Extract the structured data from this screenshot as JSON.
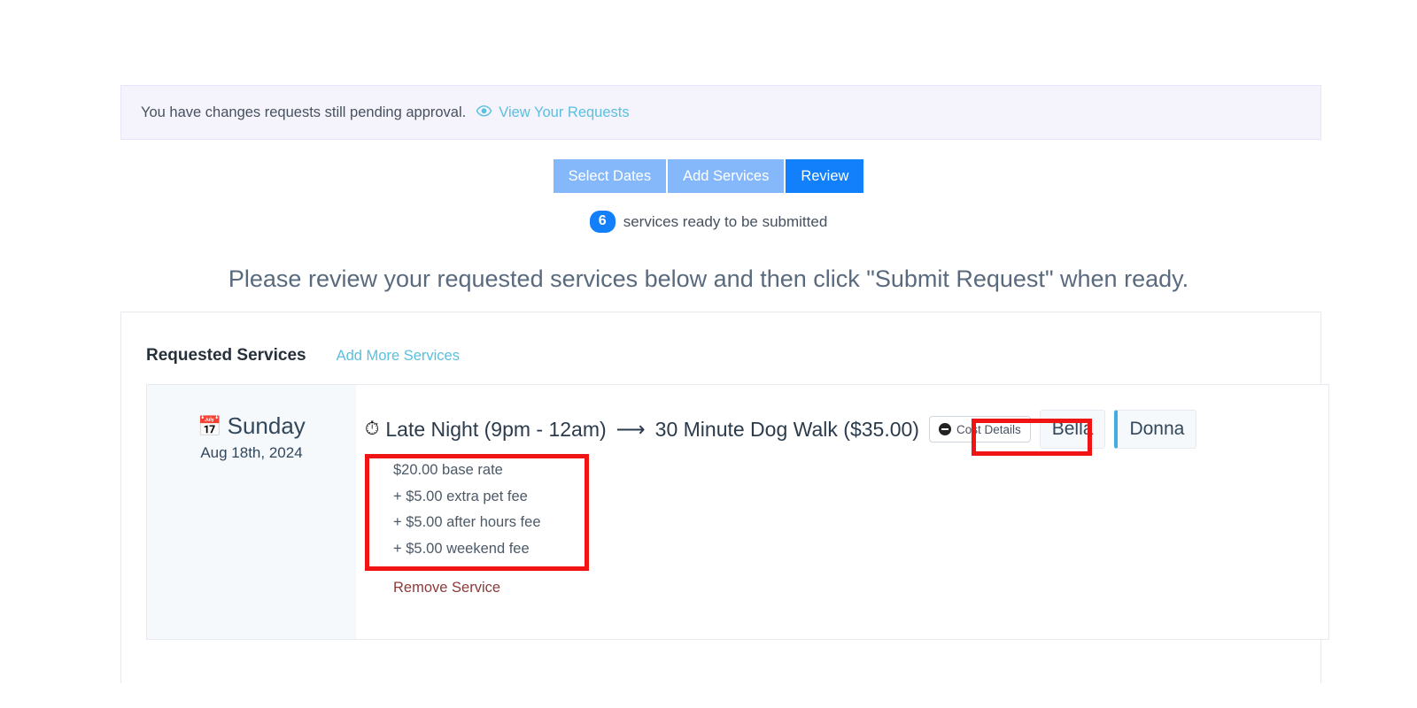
{
  "alert": {
    "message": "You have changes requests still pending approval.",
    "icon": "eye-icon",
    "link_label": "View Your Requests"
  },
  "steps": {
    "tabs": [
      {
        "label": "Select Dates",
        "active": false
      },
      {
        "label": "Add Services",
        "active": false
      },
      {
        "label": "Review",
        "active": true
      }
    ],
    "ready_count": "6",
    "ready_text": "services ready to be submitted"
  },
  "page_heading": "Please review your requested services below and then click \"Submit Request\" when ready.",
  "card": {
    "title": "Requested Services",
    "add_more_label": "Add More Services"
  },
  "service": {
    "calendar_icon": "calendar-icon",
    "day": "Sunday",
    "date": "Aug 18th, 2024",
    "clock_icon": "clock-icon",
    "time_window": "Late Night (9pm - 12am)",
    "arrow_icon": "arrow-right-icon",
    "service_name": "30 Minute Dog Walk ($35.00)",
    "cost_details_label": "Cost Details",
    "cost_details_icon": "minus-circle-icon",
    "pets": [
      {
        "name": "Bella",
        "accent": false
      },
      {
        "name": "Donna",
        "accent": true
      }
    ],
    "cost_breakdown": [
      "$20.00 base rate",
      "+ $5.00 extra pet fee",
      "+ $5.00 after hours fee",
      "+ $5.00 weekend fee"
    ],
    "remove_label": "Remove Service"
  },
  "colors": {
    "accent_blue": "#127ffb",
    "tab_inactive": "#85b8fb",
    "link_cyan": "#5bbfdd",
    "annotation_red": "#f11414",
    "remove_red": "#8b3a3a",
    "alert_bg": "#f5f4fd",
    "date_col_bg": "#f5f9fb"
  }
}
